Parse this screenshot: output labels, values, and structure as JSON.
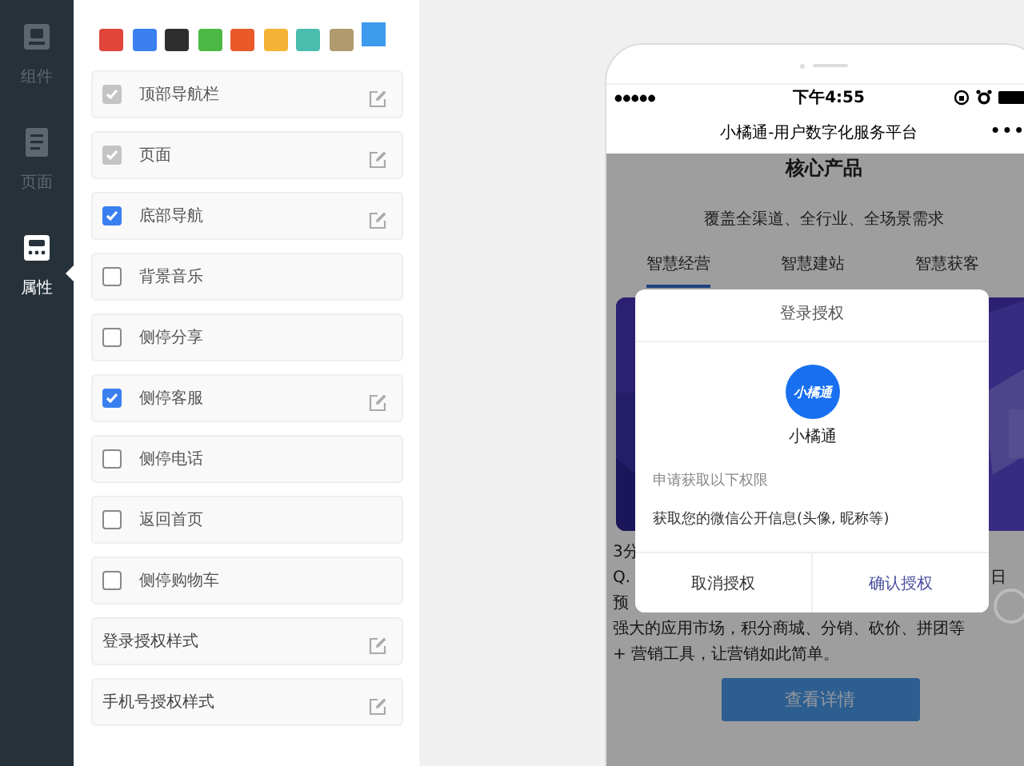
{
  "sidebar": {
    "items": [
      {
        "label": "组件",
        "selected": false
      },
      {
        "label": "页面",
        "selected": false
      },
      {
        "label": "属性",
        "selected": true
      }
    ]
  },
  "theme_colors": [
    {
      "color": "#e0453c",
      "selected": false
    },
    {
      "color": "#3a80f0",
      "selected": false
    },
    {
      "color": "#2e2e2e",
      "selected": false
    },
    {
      "color": "#4cb944",
      "selected": false
    },
    {
      "color": "#ea5a28",
      "selected": false
    },
    {
      "color": "#f5b335",
      "selected": false
    },
    {
      "color": "#4bbfaf",
      "selected": false
    },
    {
      "color": "#b09a6e",
      "selected": false
    },
    {
      "color": "#3d9bee",
      "selected": true
    }
  ],
  "settings": [
    {
      "kind": "checkbox",
      "label": "顶部导航栏",
      "checked": true,
      "disabled": true,
      "editable": true
    },
    {
      "kind": "checkbox",
      "label": "页面",
      "checked": true,
      "disabled": true,
      "editable": true
    },
    {
      "kind": "checkbox",
      "label": "底部导航",
      "checked": true,
      "disabled": false,
      "editable": true
    },
    {
      "kind": "checkbox",
      "label": "背景音乐",
      "checked": false,
      "disabled": false,
      "editable": false
    },
    {
      "kind": "checkbox",
      "label": "侧停分享",
      "checked": false,
      "disabled": false,
      "editable": false
    },
    {
      "kind": "checkbox",
      "label": "侧停客服",
      "checked": true,
      "disabled": false,
      "editable": true
    },
    {
      "kind": "checkbox",
      "label": "侧停电话",
      "checked": false,
      "disabled": false,
      "editable": false
    },
    {
      "kind": "checkbox",
      "label": "返回首页",
      "checked": false,
      "disabled": false,
      "editable": false
    },
    {
      "kind": "checkbox",
      "label": "侧停购物车",
      "checked": false,
      "disabled": false,
      "editable": false
    },
    {
      "kind": "setting",
      "label": "登录授权样式",
      "editable": true
    },
    {
      "kind": "setting",
      "label": "手机号授权样式",
      "editable": true
    }
  ],
  "phone": {
    "status_bar": {
      "time": "下午4:55"
    },
    "nav_bar": {
      "title": "小橘通-用户数字化服务平台",
      "menu": "•••"
    },
    "page": {
      "heading": "核心产品",
      "subtitle": "覆盖全渠道、全行业、全场景需求",
      "tabs": [
        {
          "label": "智慧经营",
          "selected": true
        },
        {
          "label": "智慧建站",
          "selected": false
        },
        {
          "label": "智慧获客",
          "selected": false
        }
      ],
      "banner": {
        "kind": "picture"
      },
      "text_fragments": [
        "3分",
        "Q.",
        "预"
      ],
      "right_fragment": "日",
      "description": [
        "强大的应用市场，积分商城、分销、砍价、拼团等",
        "+ 营销工具，让营销如此简单。"
      ],
      "button": "查看详情"
    },
    "dialog": {
      "title": "登录授权",
      "logo_text": "小橘通",
      "app_name": "小橘通",
      "permission_heading": "申请获取以下权限",
      "permission": "获取您的微信公开信息(头像, 昵称等)",
      "buttons": [
        {
          "label": "取消授权",
          "primary": false
        },
        {
          "label": "确认授权",
          "primary": true
        }
      ]
    }
  }
}
